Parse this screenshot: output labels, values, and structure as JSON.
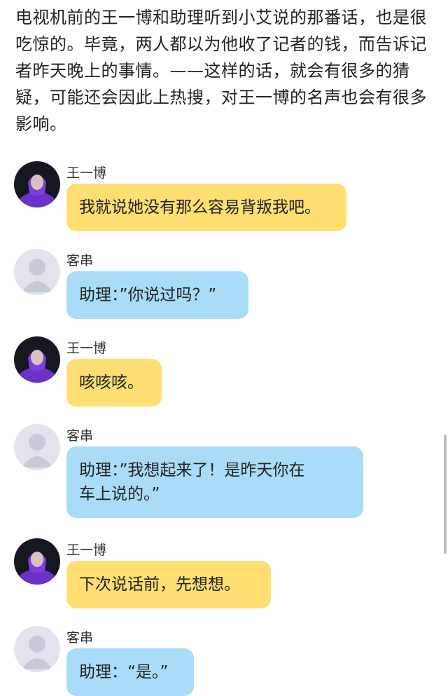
{
  "intro_text": "电视机前的王一博和助理听到小艾说的那番话，也是很吃惊的。毕竟，两人都以为他收了记者的钱，而告诉记者昨天晚上的事情。——这样的话，就会有很多的猜疑，可能还会因此上热搜，对王一博的名声也会有很多影响。",
  "messages": [
    {
      "sender": "王一博",
      "text": "我就说她没有那么容易背叛我吧。",
      "color": "#ffdf72",
      "avatar": "photo-avatar"
    },
    {
      "sender": "客串",
      "text": "助理：”你说过吗？”",
      "color": "#a9dcf8",
      "avatar": "default-user-avatar"
    },
    {
      "sender": "王一博",
      "text": "咳咳咳。",
      "color": "#ffdf72",
      "avatar": "photo-avatar"
    },
    {
      "sender": "客串",
      "text_line1": "助理：”我想起来了！是昨天你在",
      "text_line2": "车上说的。”",
      "color": "#a9dcf8",
      "avatar": "default-user-avatar"
    },
    {
      "sender": "王一博",
      "text": "下次说话前，先想想。",
      "color": "#ffdf72",
      "avatar": "photo-avatar"
    },
    {
      "sender": "客串",
      "text": "助理：“是。”",
      "color": "#a9dcf8",
      "avatar": "default-user-avatar"
    }
  ]
}
